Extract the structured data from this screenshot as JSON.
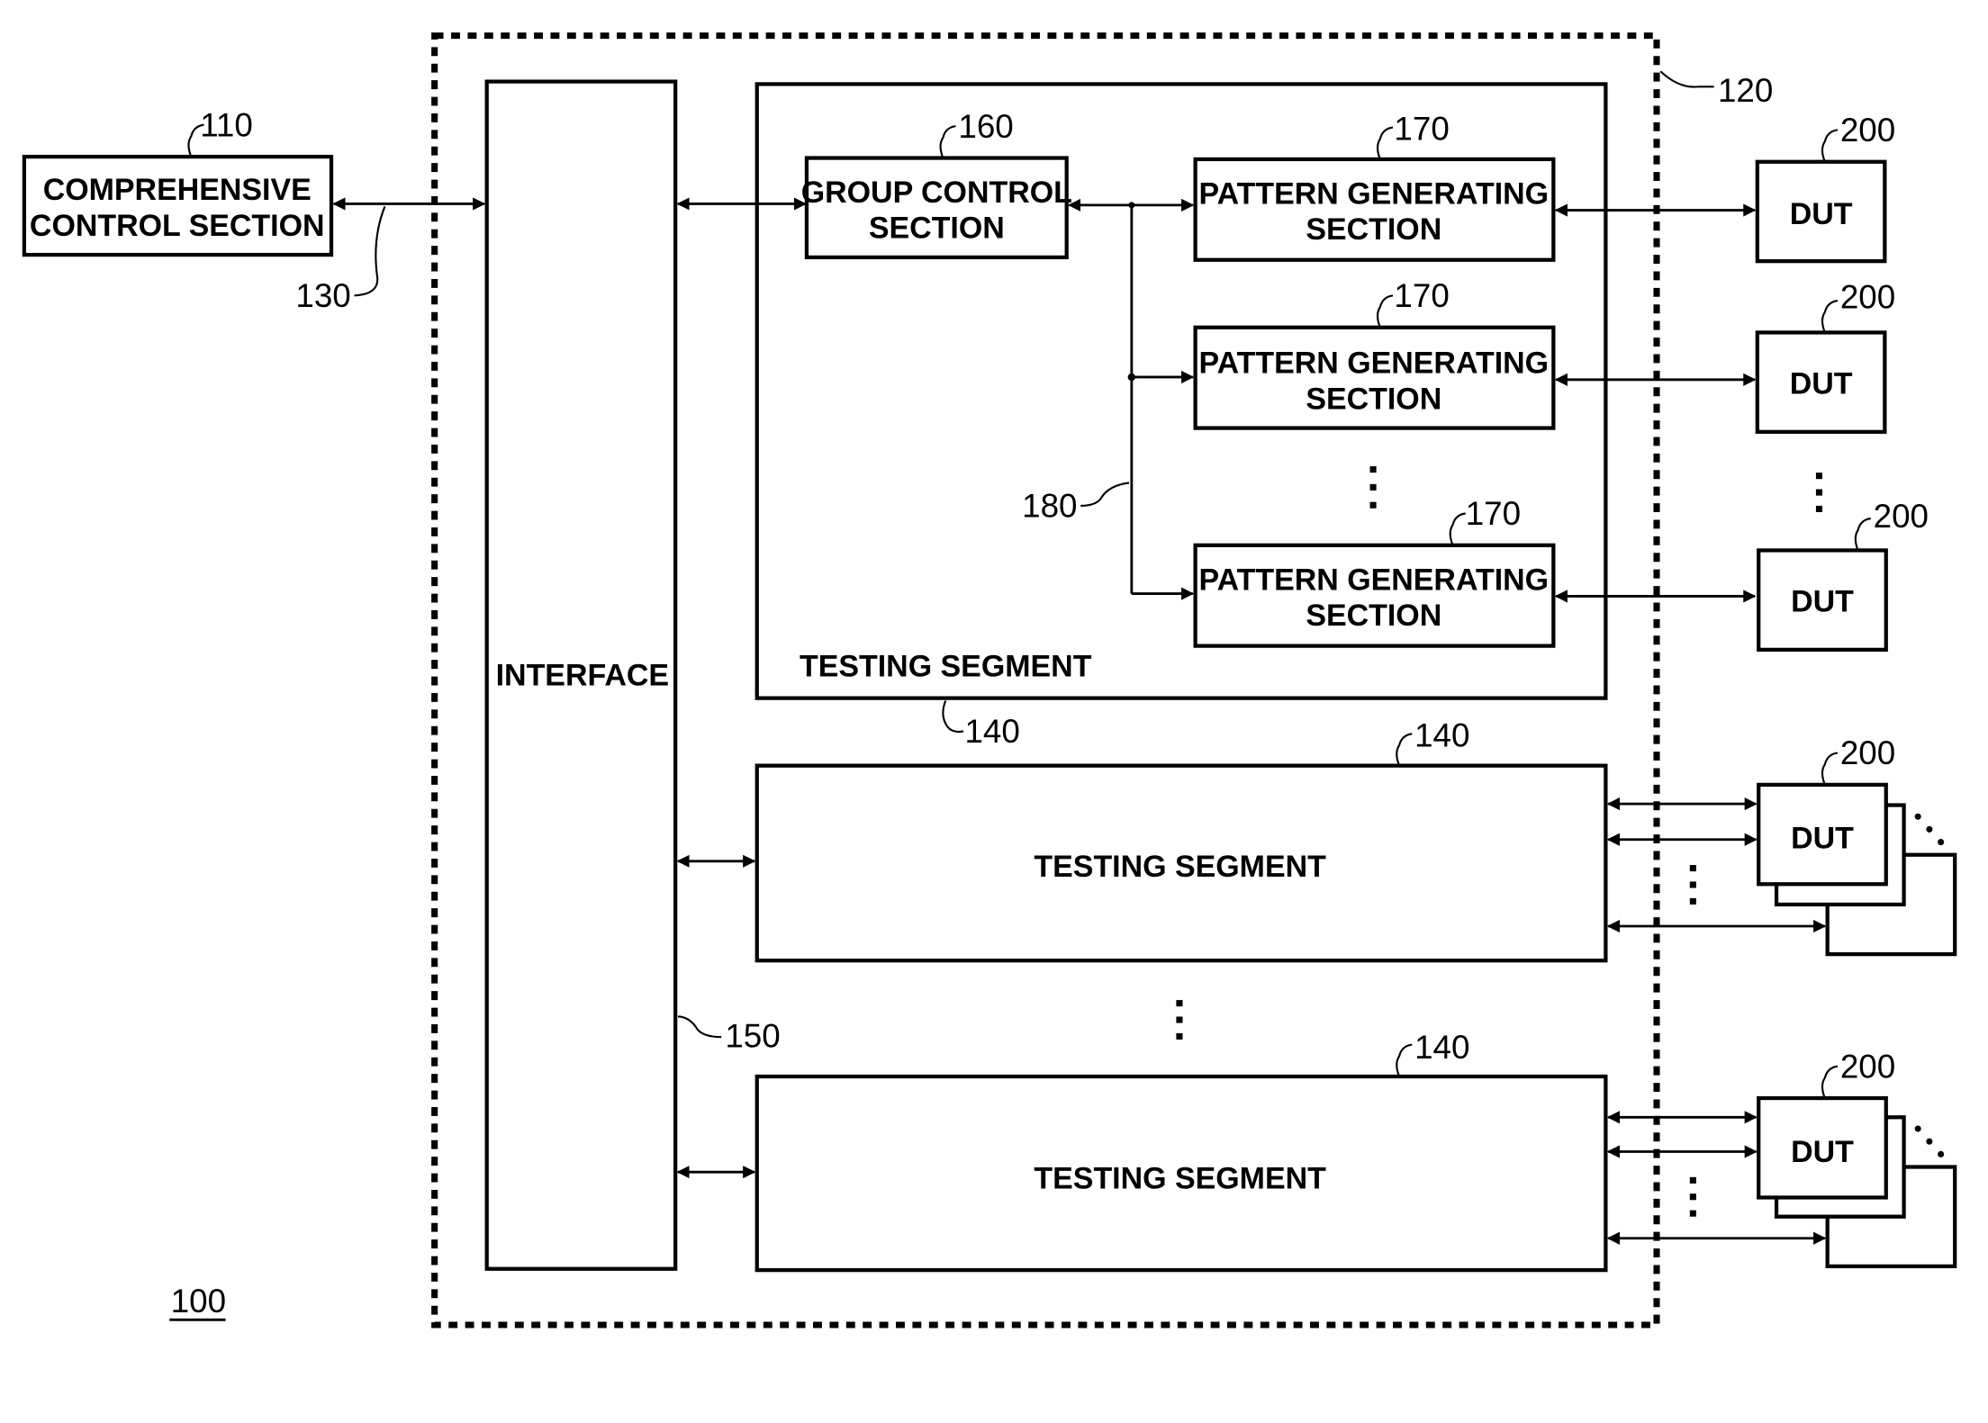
{
  "figure": {
    "label": "100",
    "comprehensive": {
      "line1": "COMPREHENSIVE",
      "line2": "CONTROL SECTION",
      "ref": "110"
    },
    "bus_ref": "130",
    "tester_ref": "120",
    "interface": {
      "label": "INTERFACE",
      "ref": "150"
    },
    "segment_main": {
      "label": "TESTING SEGMENT",
      "ref": "140"
    },
    "group_control": {
      "line1": "GROUP CONTROL",
      "line2": "SECTION",
      "ref": "160"
    },
    "internal_bus_ref": "180",
    "pattern_generators": [
      {
        "line1": "PATTERN GENERATING",
        "line2": "SECTION",
        "ref": "170"
      },
      {
        "line1": "PATTERN GENERATING",
        "line2": "SECTION",
        "ref": "170"
      },
      {
        "line1": "PATTERN GENERATING",
        "line2": "SECTION",
        "ref": "170"
      }
    ],
    "duts_top": [
      {
        "label": "DUT",
        "ref": "200"
      },
      {
        "label": "DUT",
        "ref": "200"
      },
      {
        "label": "DUT",
        "ref": "200"
      }
    ],
    "segments_other": [
      {
        "label": "TESTING SEGMENT",
        "ref": "140",
        "dut_label": "DUT",
        "dut_ref": "200"
      },
      {
        "label": "TESTING SEGMENT",
        "ref": "140",
        "dut_label": "DUT",
        "dut_ref": "200"
      }
    ]
  }
}
